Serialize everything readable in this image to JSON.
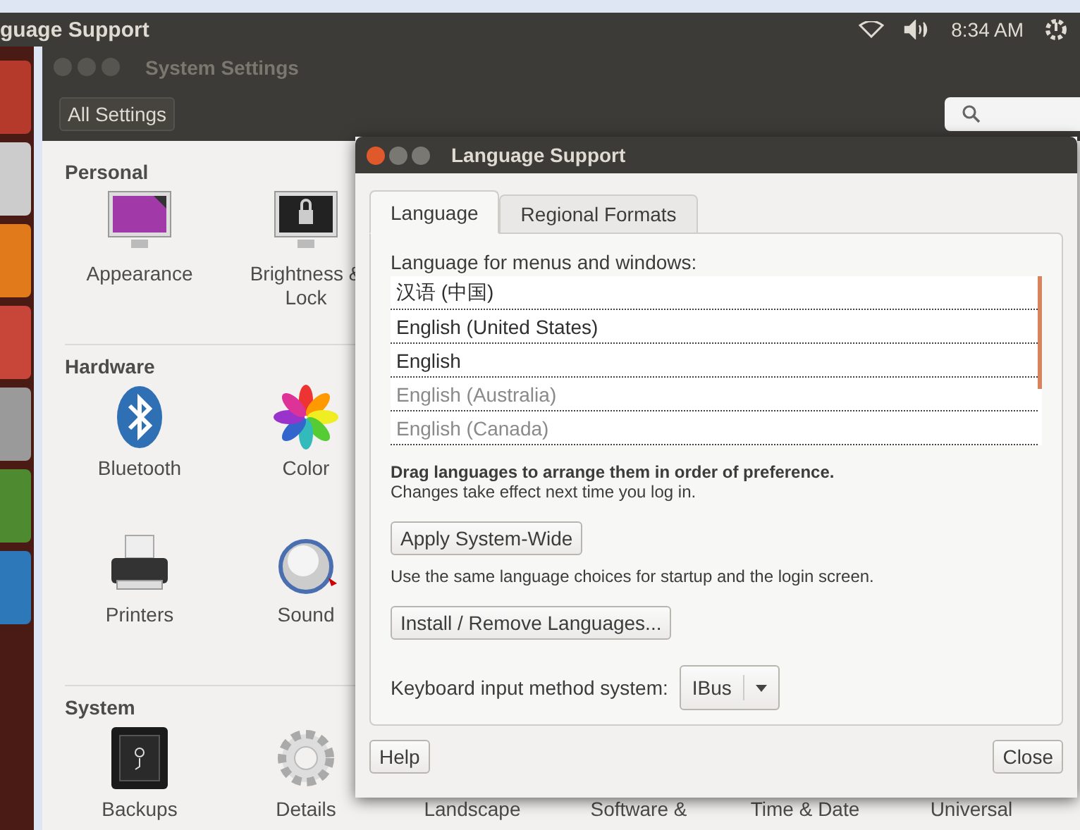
{
  "top_panel": {
    "app_title": "guage Support",
    "clock": "8:34 AM"
  },
  "settings_window": {
    "title": "System Settings",
    "all_settings_button": "All Settings",
    "sections": [
      {
        "title": "Personal",
        "rows": [
          [
            {
              "label": "Appearance",
              "kind": "appearance"
            },
            {
              "label": "Brightness & Lock",
              "kind": "lock"
            }
          ]
        ]
      },
      {
        "title": "Hardware",
        "rows": [
          [
            {
              "label": "Bluetooth",
              "kind": "bluetooth"
            },
            {
              "label": "Color",
              "kind": "color"
            }
          ],
          [
            {
              "label": "Printers",
              "kind": "printer"
            },
            {
              "label": "Sound",
              "kind": "sound"
            }
          ]
        ]
      },
      {
        "title": "System",
        "rows": [
          [
            {
              "label": "Backups",
              "kind": "safe"
            },
            {
              "label": "Details",
              "kind": "gear"
            },
            {
              "label": "Landscape",
              "kind": "hidden"
            },
            {
              "label": "Software &",
              "kind": "hidden"
            },
            {
              "label": "Time & Date",
              "kind": "hidden"
            },
            {
              "label": "Universal",
              "kind": "hidden"
            }
          ]
        ]
      }
    ]
  },
  "dialog": {
    "title": "Language Support",
    "tabs": [
      {
        "label": "Language",
        "selected": true
      },
      {
        "label": "Regional Formats",
        "selected": false
      }
    ],
    "list_label": "Language for menus and windows:",
    "languages": [
      {
        "name": "汉语 (中国)",
        "active": true
      },
      {
        "name": "English (United States)",
        "active": true
      },
      {
        "name": "English",
        "active": true
      },
      {
        "name": "English (Australia)",
        "active": false
      },
      {
        "name": "English (Canada)",
        "active": false
      }
    ],
    "hint_bold": "Drag languages to arrange them in order of preference.",
    "hint": "Changes take effect next time you log in.",
    "apply_button": "Apply System-Wide",
    "apply_note": "Use the same language choices for startup and the login screen.",
    "install_button": "Install / Remove Languages...",
    "input_method_label": "Keyboard input method system:",
    "input_method_value": "IBus",
    "help_button": "Help",
    "close_button": "Close"
  }
}
